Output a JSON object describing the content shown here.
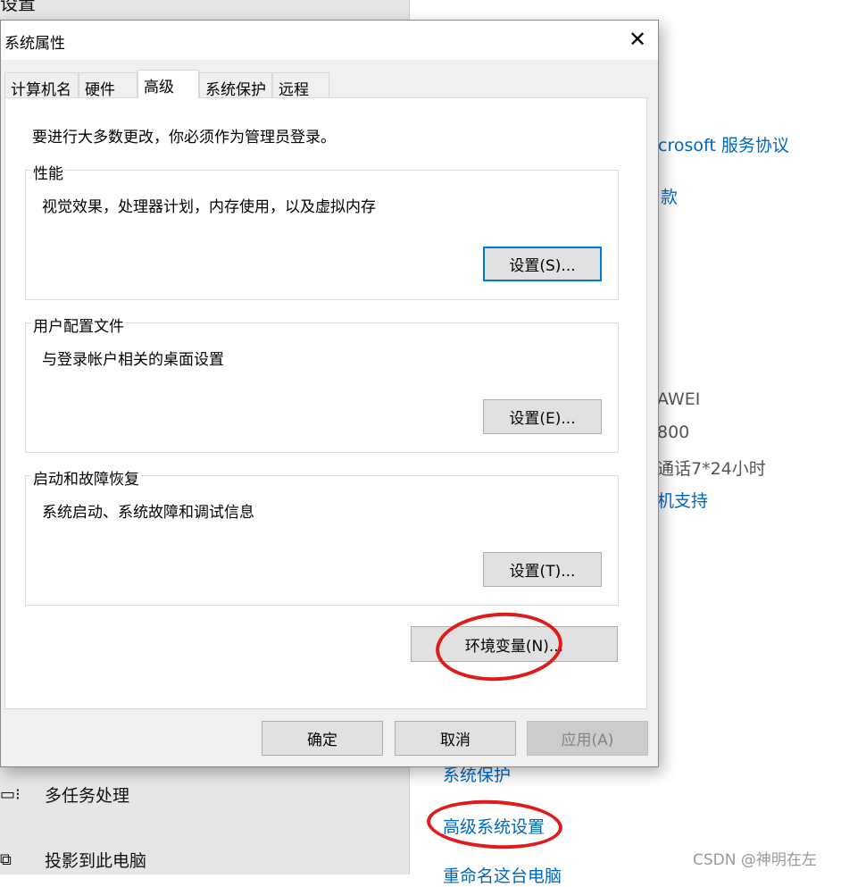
{
  "settings_window": {
    "title": "设置",
    "nav": [
      {
        "icon": "multitasking-icon",
        "label": "多任务处理"
      },
      {
        "icon": "project-icon",
        "label": "投影到此电脑"
      }
    ],
    "right_links": [
      "crosoft 服务协议",
      "款"
    ],
    "right_info": [
      "AWEI",
      "800",
      "通话7*24小时"
    ],
    "support_link": "机支持",
    "related_links": [
      "系统保护",
      "高级系统设置",
      "重命名这台电脑"
    ]
  },
  "dialog": {
    "title": "系统属性",
    "tabs": [
      {
        "label": "计算机名"
      },
      {
        "label": "硬件"
      },
      {
        "label": "高级",
        "active": true
      },
      {
        "label": "系统保护"
      },
      {
        "label": "远程"
      }
    ],
    "admin_note": "要进行大多数更改，你必须作为管理员登录。",
    "groups": [
      {
        "label": "性能",
        "desc": "视觉效果，处理器计划，内存使用，以及虚拟内存",
        "button": "设置(S)..."
      },
      {
        "label": "用户配置文件",
        "desc": "与登录帐户相关的桌面设置",
        "button": "设置(E)..."
      },
      {
        "label": "启动和故障恢复",
        "desc": "系统启动、系统故障和调试信息",
        "button": "设置(T)..."
      }
    ],
    "env_button": "环境变量(N)...",
    "ok": "确定",
    "cancel": "取消",
    "apply": "应用(A)"
  },
  "annotation_color": "#e01b1b",
  "watermark": "CSDN @神明在左"
}
